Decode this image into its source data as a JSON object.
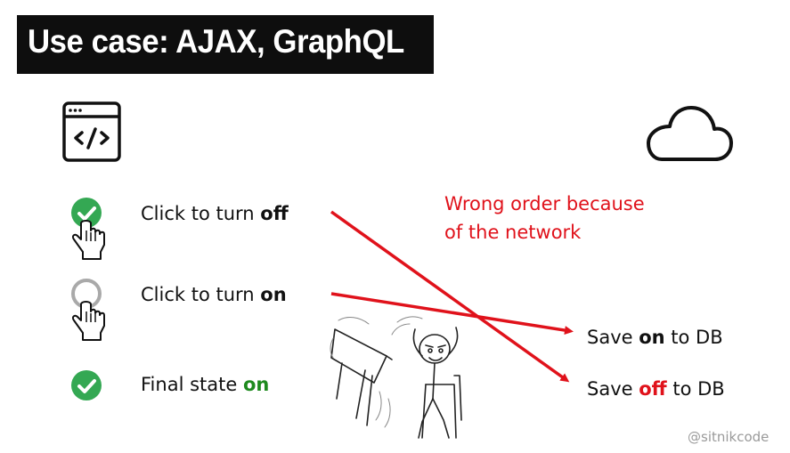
{
  "title": "Use case: AJAX, GraphQL",
  "icons": {
    "client": "browser-code-icon",
    "server": "cloud-icon"
  },
  "rows": [
    {
      "prefix": "Click to turn ",
      "keyword": "off",
      "icon": "checked-toggle-pointer-icon"
    },
    {
      "prefix": "Click to turn ",
      "keyword": "on",
      "icon": "unchecked-toggle-pointer-icon"
    },
    {
      "prefix": "Final state ",
      "keyword": "on",
      "icon": "checked-icon"
    }
  ],
  "note": {
    "line1": "Wrong order because",
    "line2": "of the network"
  },
  "saves": [
    {
      "prefix": "Save ",
      "keyword": "on",
      "suffix": " to DB"
    },
    {
      "prefix": "Save ",
      "keyword": "off",
      "suffix": " to DB"
    }
  ],
  "illustration": "table-flip-meme",
  "credit": "@sitnikcode",
  "colors": {
    "check_green": "#34a853",
    "error_red": "#e0121b",
    "final_green": "#1e8a1e"
  }
}
